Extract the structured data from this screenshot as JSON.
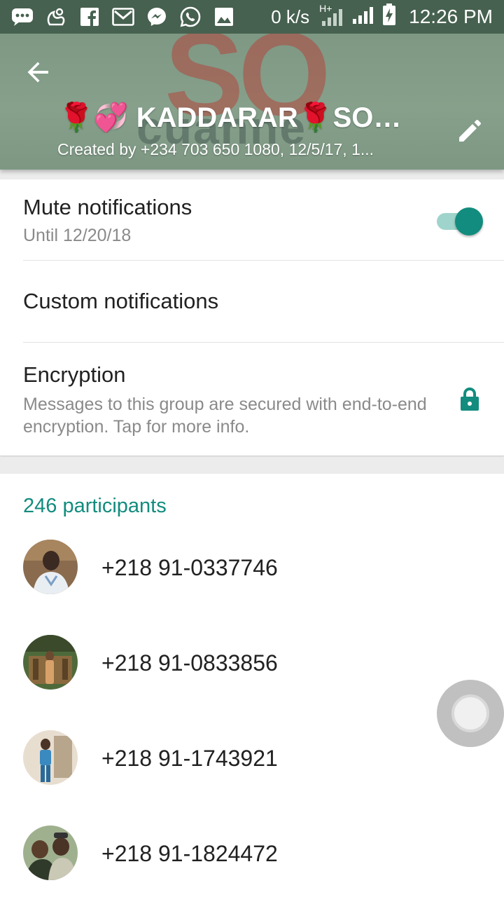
{
  "status_bar": {
    "icons": [
      "chat-bubble-icon",
      "uc-browser-icon",
      "facebook-icon",
      "gmail-icon",
      "messenger-icon",
      "whatsapp-icon",
      "gallery-icon"
    ],
    "net_speed": "0 k/s",
    "network_type": "H+",
    "time": "12:26 PM"
  },
  "header": {
    "title": "🌹💞 KADDARAR🌹SO💓...",
    "subtitle": "Created by +234 703 650 1080, 12/5/17, 1...",
    "watermark_so": "SO",
    "watermark_word": "cuanne"
  },
  "settings": {
    "mute": {
      "title": "Mute notifications",
      "subtitle": "Until 12/20/18",
      "enabled": true
    },
    "custom_notifications": {
      "title": "Custom notifications"
    },
    "encryption": {
      "title": "Encryption",
      "subtitle": "Messages to this group are secured with end-to-end encryption. Tap for more info."
    }
  },
  "participants": {
    "count_label": "246 participants",
    "items": [
      {
        "number": "+218 91-0337746"
      },
      {
        "number": "+218 91-0833856"
      },
      {
        "number": "+218 91-1743921"
      },
      {
        "number": "+218 91-1824472"
      }
    ]
  },
  "colors": {
    "accent": "#128c7e",
    "status_bar": "#46614f",
    "header": "#86a08b"
  }
}
